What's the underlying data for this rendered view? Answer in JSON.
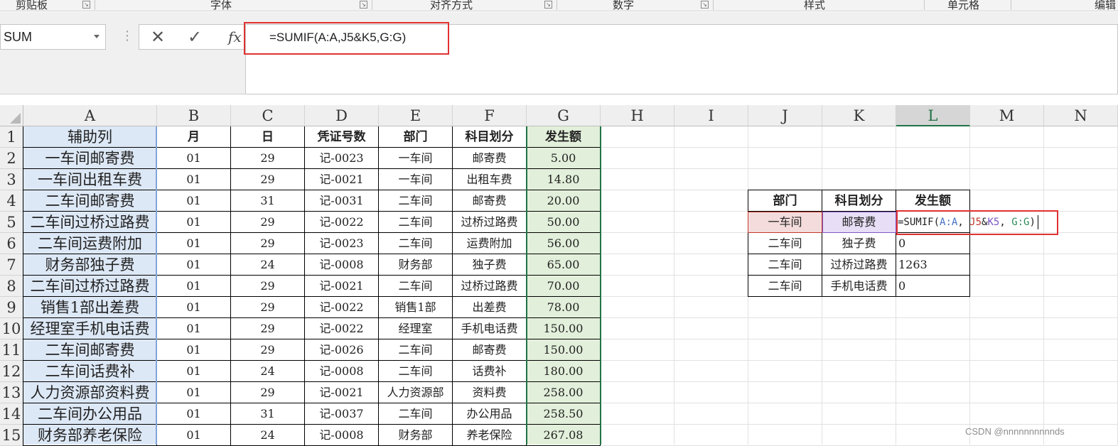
{
  "ribbon": {
    "groups": [
      "剪贴板",
      "字体",
      "对齐方式",
      "数字",
      "样式",
      "单元格",
      "编辑"
    ]
  },
  "formula_bar": {
    "name_box": "SUM",
    "formula": "=SUMIF(A:A,J5&K5,G:G)",
    "cancel_icon": "✕",
    "enter_icon": "✓",
    "fx_label": "fx"
  },
  "columns": [
    "A",
    "B",
    "C",
    "D",
    "E",
    "F",
    "G",
    "H",
    "I",
    "J",
    "K",
    "L",
    "M",
    "N"
  ],
  "rows": [
    "1",
    "2",
    "3",
    "4",
    "5",
    "6",
    "7",
    "8",
    "9",
    "10",
    "11",
    "12",
    "13",
    "14",
    "15"
  ],
  "table": {
    "headers": [
      "辅助列",
      "月",
      "日",
      "凭证号数",
      "部门",
      "科目划分",
      "发生额"
    ],
    "rows": [
      [
        "一车间邮寄费",
        "01",
        "29",
        "记-0023",
        "一车间",
        "邮寄费",
        "5.00"
      ],
      [
        "一车间出租车费",
        "01",
        "29",
        "记-0021",
        "一车间",
        "出租车费",
        "14.80"
      ],
      [
        "二车间邮寄费",
        "01",
        "31",
        "记-0031",
        "二车间",
        "邮寄费",
        "20.00"
      ],
      [
        "二车间过桥过路费",
        "01",
        "29",
        "记-0022",
        "二车间",
        "过桥过路费",
        "50.00"
      ],
      [
        "二车间运费附加",
        "01",
        "29",
        "记-0023",
        "二车间",
        "运费附加",
        "56.00"
      ],
      [
        "财务部独子费",
        "01",
        "24",
        "记-0008",
        "财务部",
        "独子费",
        "65.00"
      ],
      [
        "二车间过桥过路费",
        "01",
        "29",
        "记-0021",
        "二车间",
        "过桥过路费",
        "70.00"
      ],
      [
        "销售1部出差费",
        "01",
        "29",
        "记-0022",
        "销售1部",
        "出差费",
        "78.00"
      ],
      [
        "经理室手机电话费",
        "01",
        "29",
        "记-0022",
        "经理室",
        "手机电话费",
        "150.00"
      ],
      [
        "二车间邮寄费",
        "01",
        "29",
        "记-0026",
        "二车间",
        "邮寄费",
        "150.00"
      ],
      [
        "二车间话费补",
        "01",
        "24",
        "记-0008",
        "二车间",
        "话费补",
        "180.00"
      ],
      [
        "人力资源部资料费",
        "01",
        "29",
        "记-0021",
        "人力资源部",
        "资料费",
        "258.00"
      ],
      [
        "二车间办公用品",
        "01",
        "31",
        "记-0037",
        "二车间",
        "办公用品",
        "258.50"
      ],
      [
        "财务部养老保险",
        "01",
        "24",
        "记-0008",
        "财务部",
        "养老保险",
        "267.08"
      ]
    ]
  },
  "lookup": {
    "headers": [
      "部门",
      "科目划分",
      "发生额"
    ],
    "rows": [
      [
        "一车间",
        "邮寄费",
        "=SUMIF(A:A,J5&K5,G:G)"
      ],
      [
        "二车间",
        "独子费",
        "0"
      ],
      [
        "二车间",
        "过桥过路费",
        "1263"
      ],
      [
        "二车间",
        "手机电话费",
        "0"
      ]
    ],
    "editing_formula_parts": [
      "=SUMIF(",
      "A:A",
      ", ",
      "J5",
      "&",
      "K5",
      ", ",
      "G:G",
      ")"
    ]
  },
  "watermark": "CSDN @nnnnnnnnnnds",
  "colors": {
    "grid_line": "#e1e1e1",
    "selected_col_green": "#217346",
    "helper_col_fill": "#dde8f6",
    "amount_col_fill": "#e2efda",
    "highlight_red": "#e03131",
    "ref_blue": "#4472c4",
    "ref_red": "#c0392b",
    "ref_purple": "#7e57c2",
    "ref_green": "#2e8b57"
  }
}
